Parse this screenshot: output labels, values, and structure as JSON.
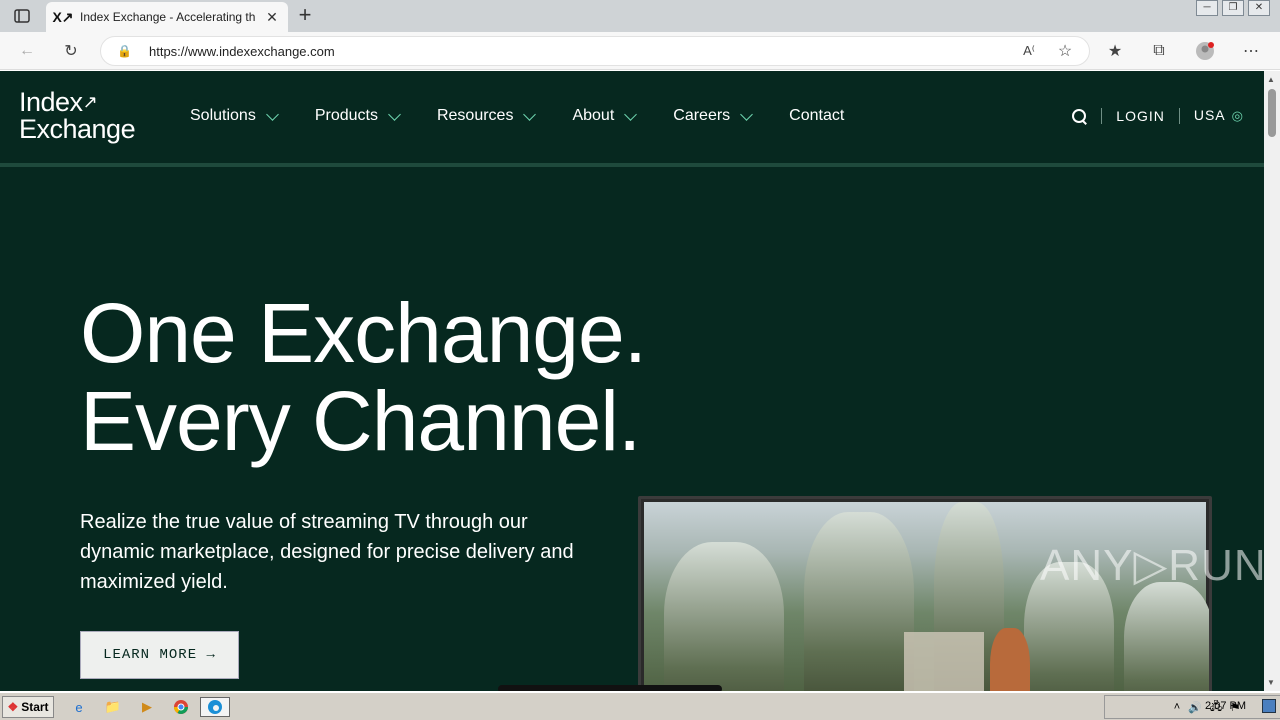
{
  "browser": {
    "tab_title": "Index Exchange - Accelerating th",
    "tab_favicon": "X↗",
    "new_tab_label": "+",
    "close_tab_label": "✕",
    "url": "https://www.indexexchange.com",
    "window_controls": [
      "─",
      "❐",
      "✕"
    ]
  },
  "header": {
    "logo_line1": "Index",
    "logo_arrow": "↗",
    "logo_line2": "Exchange",
    "nav": [
      {
        "label": "Solutions",
        "has_dropdown": true
      },
      {
        "label": "Products",
        "has_dropdown": true
      },
      {
        "label": "Resources",
        "has_dropdown": true
      },
      {
        "label": "About",
        "has_dropdown": true
      },
      {
        "label": "Careers",
        "has_dropdown": true
      },
      {
        "label": "Contact",
        "has_dropdown": false
      }
    ],
    "login_label": "LOGIN",
    "region_label": "USA",
    "globe_glyph": "◎"
  },
  "hero": {
    "title_line1": "One Exchange.",
    "title_line2": "Every Channel.",
    "subtitle": "Realize the true value of streaming TV through our dynamic marketplace, designed for precise delivery and maximized yield.",
    "cta_label": "LEARN MORE →"
  },
  "watermark": "ANY▷RUN",
  "taskbar": {
    "start_label": "Start",
    "clock": "2:07 PM",
    "apps": [
      "ie-icon",
      "folder-icon",
      "media-player-icon",
      "chrome-icon",
      "edge-icon"
    ]
  },
  "colors": {
    "page_bg": "#06281f",
    "accent": "#6fd6b0",
    "divider": "#1e4a3c"
  }
}
